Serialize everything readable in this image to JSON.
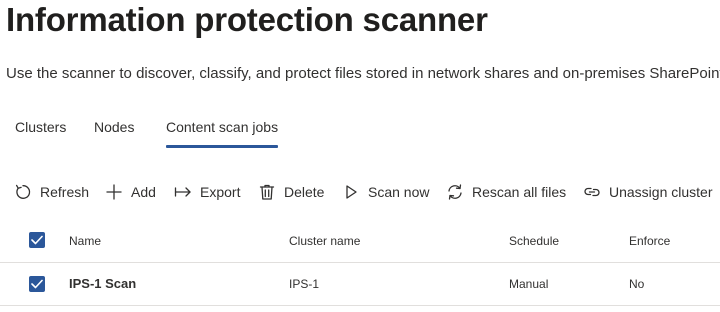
{
  "page": {
    "title": "Information protection scanner",
    "subtitle": "Use the scanner to discover, classify, and protect files stored in network shares and on-premises SharePoint"
  },
  "tabs": [
    {
      "label": "Clusters",
      "active": false
    },
    {
      "label": "Nodes",
      "active": false
    },
    {
      "label": "Content scan jobs",
      "active": true
    }
  ],
  "toolbar": {
    "refresh": {
      "label": "Refresh",
      "icon": "refresh-icon"
    },
    "add": {
      "label": "Add",
      "icon": "plus-icon"
    },
    "export": {
      "label": "Export",
      "icon": "export-arrow-icon"
    },
    "delete": {
      "label": "Delete",
      "icon": "trash-icon"
    },
    "scan_now": {
      "label": "Scan now",
      "icon": "play-icon"
    },
    "rescan_all": {
      "label": "Rescan all files",
      "icon": "rescan-icon"
    },
    "unassign": {
      "label": "Unassign cluster",
      "icon": "unlink-icon"
    }
  },
  "table": {
    "select_all_checked": true,
    "columns": [
      "Name",
      "Cluster name",
      "Schedule",
      "Enforce"
    ],
    "rows": [
      {
        "checked": true,
        "name": "IPS-1 Scan",
        "cluster": "IPS-1",
        "schedule": "Manual",
        "enforce": "No"
      }
    ]
  },
  "colors": {
    "accent": "#2b579a",
    "text": "#323130",
    "divider": "#e1dfdd"
  }
}
